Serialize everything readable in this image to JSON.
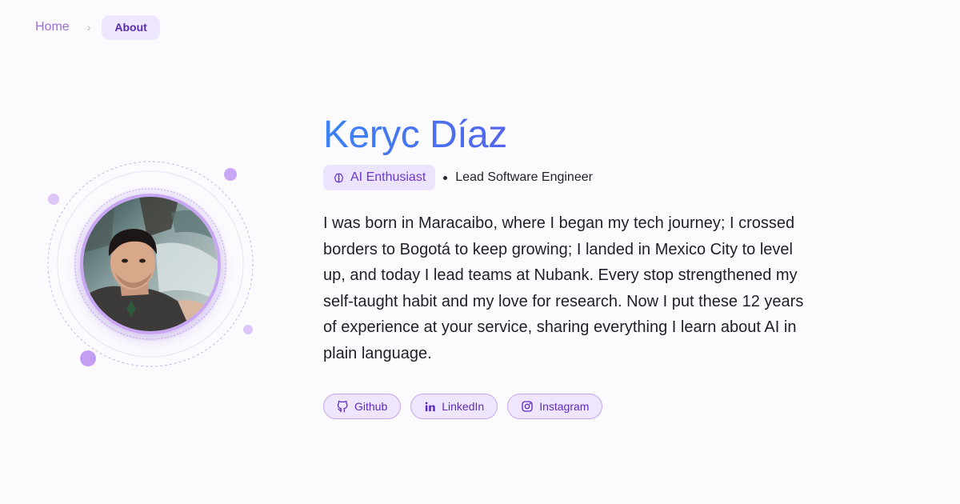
{
  "breadcrumb": {
    "home": "Home",
    "separator": "›",
    "current": "About"
  },
  "profile": {
    "name": "Keryc Díaz",
    "badge": {
      "icon": "brain-icon",
      "label": "AI Enthusiast"
    },
    "role": "Lead Software Engineer",
    "bio": "I was born in Maracaibo, where I began my tech journey; I crossed borders to Bogotá to keep growing; I landed in Mexico City to level up, and today I lead teams at Nubank. Every stop strengthened my self-taught habit and my love for research. Now I put these 12 years of experience at your service, sharing everything I learn about AI in plain language."
  },
  "socials": [
    {
      "icon": "github-icon",
      "label": "Github"
    },
    {
      "icon": "linkedin-icon",
      "label": "LinkedIn"
    },
    {
      "icon": "instagram-icon",
      "label": "Instagram"
    }
  ],
  "colors": {
    "accent": "#6d35e0",
    "accent_soft": "#efe6fd",
    "name_gradient_start": "#3b82f6",
    "name_gradient_end": "#6d35e0",
    "background": "#fbfbfe"
  }
}
